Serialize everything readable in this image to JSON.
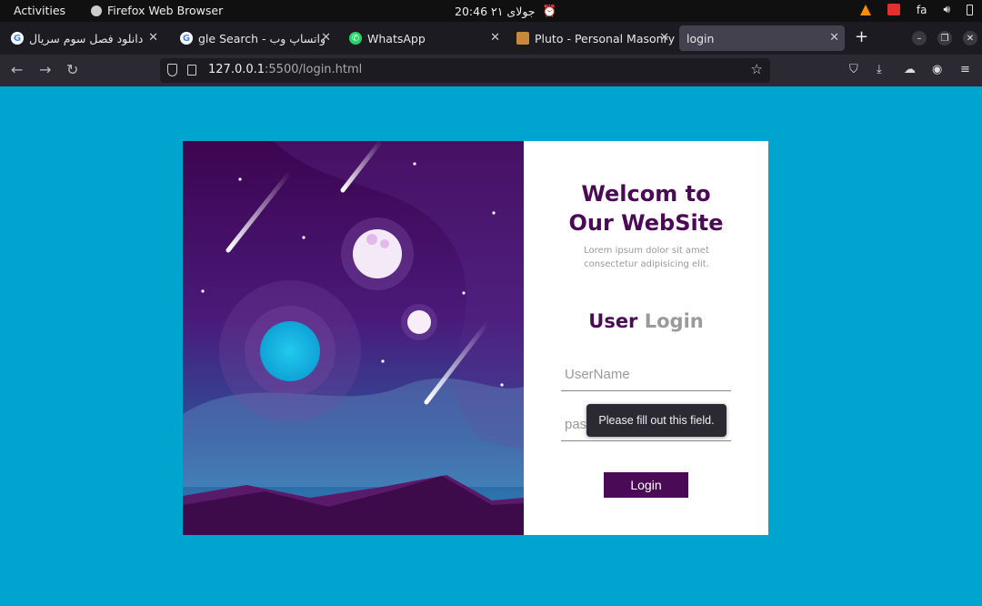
{
  "system_bar": {
    "activities": "Activities",
    "app_name": "Firefox Web Browser",
    "clock": "جولای ۲۱  20:46",
    "lang": "fa"
  },
  "tabs": [
    {
      "title": "دانلود فصل سوم سریال",
      "favicon": "google-icon",
      "active": false
    },
    {
      "title": "gle Search - واتساپ وب",
      "favicon": "google-icon",
      "active": false
    },
    {
      "title": "WhatsApp",
      "favicon": "whatsapp-icon",
      "active": false
    },
    {
      "title": "Pluto - Personal Masonry",
      "favicon": "pluto-icon",
      "active": false
    },
    {
      "title": "login",
      "favicon": "",
      "active": true
    }
  ],
  "urlbar": {
    "host": "127.0.0.1",
    "path": ":5500/login.html"
  },
  "colors": {
    "background": "#00a5cf",
    "accent": "#4a0a55"
  },
  "form": {
    "welcome_line1": "Welcom to",
    "welcome_line2": "Our WebSite",
    "lorem": "Lorem ipsum dolor sit amet consectetur adipisicing elit.",
    "heading_user": "User",
    "heading_login": "Login",
    "username_placeholder": "UserName",
    "password_placeholder": "password",
    "login_button": "Login",
    "tooltip": "Please fill out this field."
  }
}
